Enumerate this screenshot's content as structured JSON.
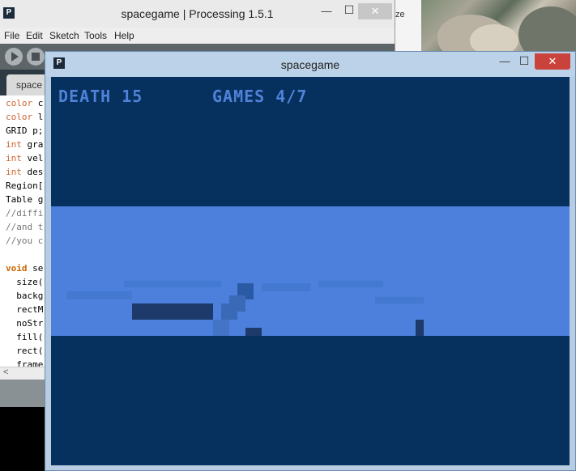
{
  "desktop": {
    "fragment_text": "ze"
  },
  "ide": {
    "title": "spacegame | Processing 1.5.1",
    "logo_letter": "P",
    "minimize": "—",
    "maximize": "☐",
    "close": "✕",
    "menu": [
      "File",
      "Edit",
      "Sketch",
      "Tools",
      "Help"
    ],
    "tab_label": "space",
    "code_lines": [
      {
        "a": "color",
        "b": " c"
      },
      {
        "a": "color",
        "b": " l"
      },
      {
        "a": "",
        "b": "GRID p;"
      },
      {
        "a": "int",
        "b": " gra"
      },
      {
        "a": "int",
        "b": " vel"
      },
      {
        "a": "int",
        "b": " des"
      },
      {
        "a": "",
        "b": "Region["
      },
      {
        "a": "",
        "b": "Table g"
      },
      {
        "a": "",
        "b": "//diffi"
      },
      {
        "a": "",
        "b": "//and t"
      },
      {
        "a": "",
        "b": "//you c"
      },
      {
        "a": "",
        "b": ""
      },
      {
        "a": "void",
        "b": " se"
      },
      {
        "a": "",
        "b": "  size("
      },
      {
        "a": "",
        "b": "  backg"
      },
      {
        "a": "",
        "b": "  rectM"
      },
      {
        "a": "",
        "b": "  noStr"
      },
      {
        "a": "",
        "b": "  fill("
      },
      {
        "a": "",
        "b": "  rect("
      },
      {
        "a": "",
        "b": "  frame"
      }
    ],
    "hscroll_left": "<"
  },
  "sketch": {
    "title": "spacegame",
    "logo_letter": "P",
    "minimize": "—",
    "maximize": "☐",
    "close": "✕",
    "hud": {
      "death_text": "DEATH 15",
      "games_text": "GAMES 4/7"
    },
    "colors": {
      "sky": "#06305e",
      "band": "#4c80dc",
      "hud": "#4f82d8",
      "dark_block": "#1d3a6a"
    }
  }
}
